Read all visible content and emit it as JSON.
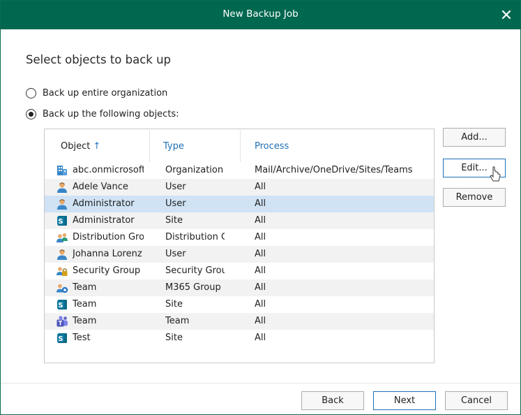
{
  "window": {
    "title": "New Backup Job"
  },
  "page": {
    "heading": "Select objects to back up"
  },
  "options": [
    {
      "label": "Back up entire organization",
      "checked": false
    },
    {
      "label": "Back up the following objects:",
      "checked": true
    }
  ],
  "grid": {
    "columns": {
      "object": "Object",
      "type": "Type",
      "process": "Process"
    },
    "sort_indicator": "↑",
    "rows": [
      {
        "object": "abc.onmicrosoft.com",
        "type": "Organization",
        "process": "Mail/Archive/OneDrive/Sites/Teams",
        "icon": "organization-icon"
      },
      {
        "object": "Adele Vance",
        "type": "User",
        "process": "All",
        "icon": "user-icon"
      },
      {
        "object": "Administrator",
        "type": "User",
        "process": "All",
        "icon": "user-icon"
      },
      {
        "object": "Administrator",
        "type": "Site",
        "process": "All",
        "icon": "sharepoint-site-icon"
      },
      {
        "object": "Distribution Group",
        "type": "Distribution Group",
        "process": "All",
        "icon": "group-icon"
      },
      {
        "object": "Johanna Lorenz",
        "type": "User",
        "process": "All",
        "icon": "user-icon"
      },
      {
        "object": "Security Group",
        "type": "Security Group",
        "process": "All",
        "icon": "security-group-icon"
      },
      {
        "object": "Team",
        "type": "M365 Group",
        "process": "All",
        "icon": "m365-group-icon"
      },
      {
        "object": "Team",
        "type": "Site",
        "process": "All",
        "icon": "sharepoint-site-icon"
      },
      {
        "object": "Team",
        "type": "Team",
        "process": "All",
        "icon": "teams-icon"
      },
      {
        "object": "Test",
        "type": "Site",
        "process": "All",
        "icon": "sharepoint-site-icon"
      }
    ],
    "selected_row": 2
  },
  "side_buttons": {
    "add": "Add...",
    "edit": "Edit...",
    "remove": "Remove"
  },
  "footer": {
    "back": "Back",
    "next": "Next",
    "cancel": "Cancel"
  },
  "colors": {
    "titlebar": "#00684f",
    "accent": "#1e6fb5",
    "selection": "#cfe3f5"
  }
}
